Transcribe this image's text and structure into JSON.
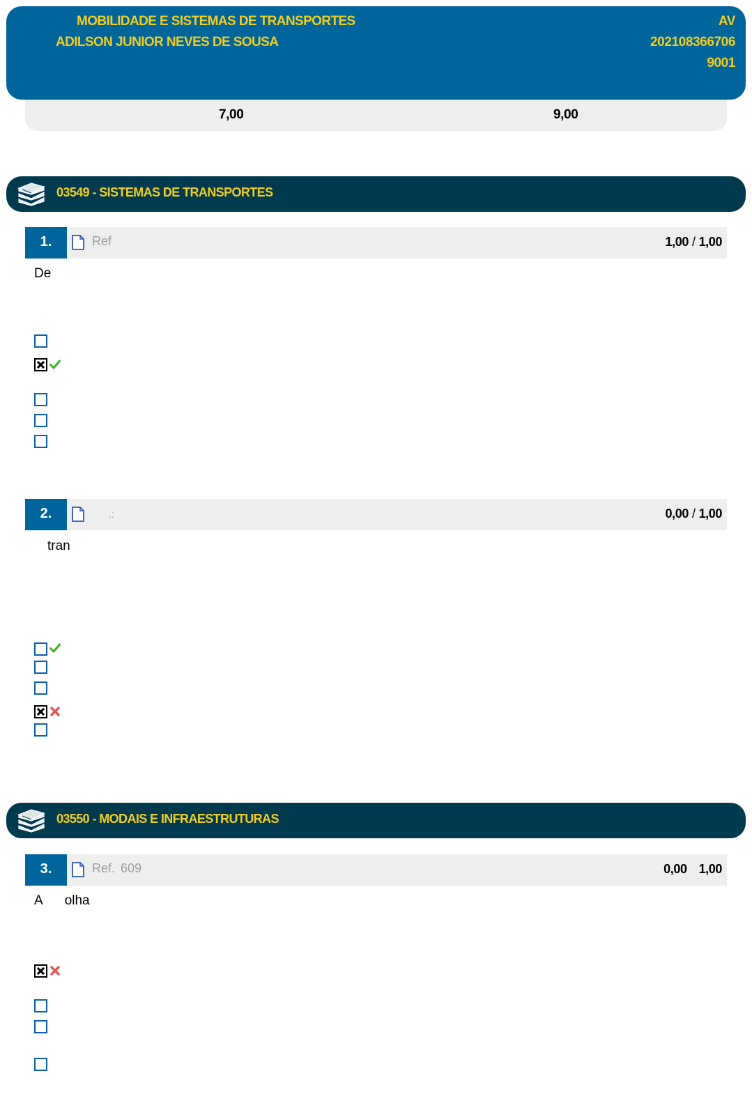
{
  "header": {
    "course": "MOBILIDADE E SISTEMAS DE TRANSPORTES",
    "student": "ADILSON JUNIOR NEVES DE SOUSA",
    "right_line1": "AV",
    "right_line2": "202108366706",
    "right_line3": "9001"
  },
  "scores": {
    "score_a": "7,00",
    "score_b": "9,00"
  },
  "sections": [
    {
      "title": "03549 - SISTEMAS DE TRANSPORTES"
    },
    {
      "title": "03550 - MODAIS E INFRAESTRUTURAS"
    }
  ],
  "questions": [
    {
      "number": "1.",
      "ref_label": "Ref",
      "ref_number": "",
      "score": "1,00",
      "separator": "/",
      "max": "1,00",
      "text": "De"
    },
    {
      "number": "2.",
      "ref_label": ".:",
      "ref_number": "",
      "score": "0,00",
      "separator": "/",
      "max": "1,00",
      "text": "tran"
    },
    {
      "number": "3.",
      "ref_label": "Ref.",
      "ref_number": "609",
      "score": "0,00",
      "separator": "",
      "max": "1,00",
      "text_a": "A",
      "text_b": "olha"
    }
  ],
  "icons": {
    "section_icon": "books-icon",
    "question_icon": "document-icon",
    "correct_icon": "check-icon",
    "wrong_icon": "cross-icon"
  },
  "colors": {
    "header_bg": "#00659b",
    "section_bg": "#013a4f",
    "accent_text": "#f3cd1f",
    "bar_bg": "#eeeeee",
    "correct": "#3cb521",
    "wrong": "#e05555"
  }
}
